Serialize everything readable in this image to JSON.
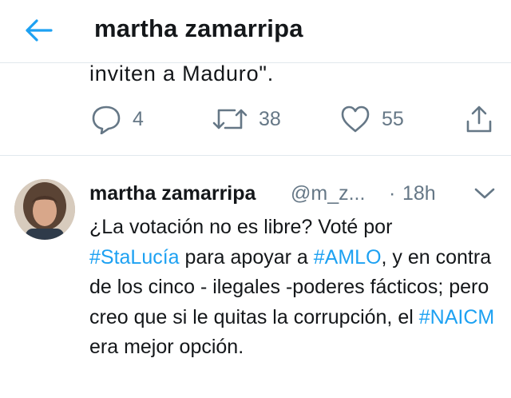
{
  "header": {
    "title": "martha zamarripa",
    "back_icon": "back-arrow-icon",
    "accent_color": "#1da1f2"
  },
  "previous_tweet": {
    "cut_text": "inviten a Maduro\".",
    "actions": {
      "reply_count": "4",
      "retweet_count": "38",
      "like_count": "55"
    }
  },
  "tweet": {
    "name": "martha zamarripa",
    "handle": "@m_z...",
    "separator": "·",
    "time": "18h",
    "body": {
      "t1": "¿La votación no es libre? Voté por",
      "tag1": "#StaLucía",
      "t2": " para apoyar a ",
      "tag2": "#AMLO",
      "t3": ", y en contra de los cinco - ilegales -poderes fácticos; pero creo que si le quitas la corrupción, el ",
      "tag3": "#NAICM",
      "t4": " era mejor opción."
    }
  }
}
